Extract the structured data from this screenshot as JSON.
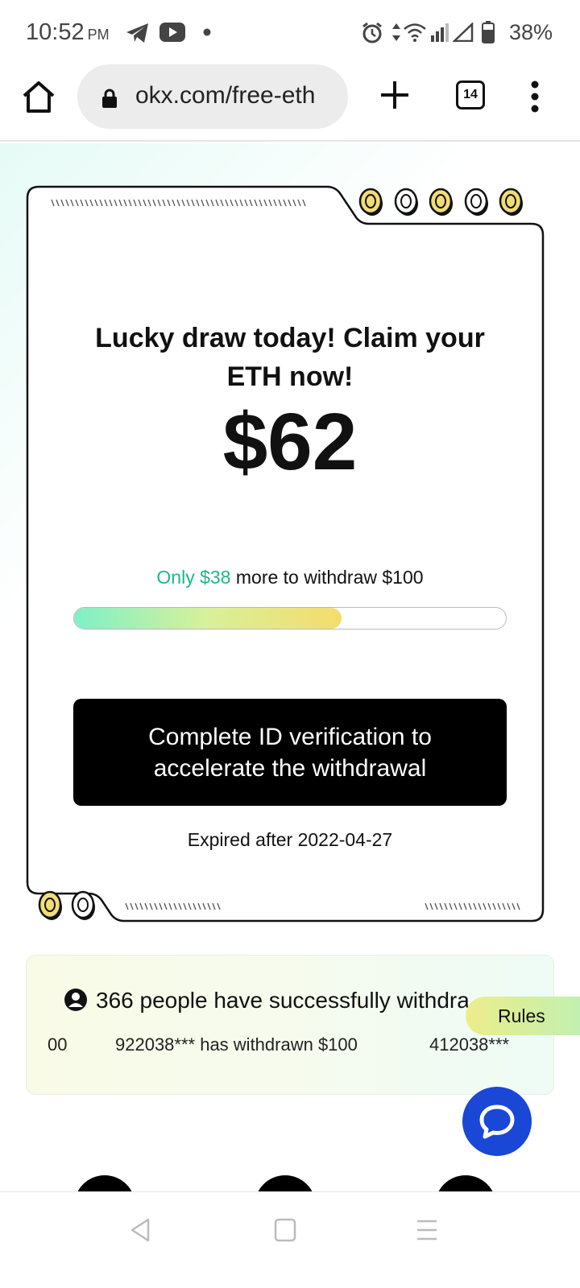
{
  "status_bar": {
    "time": "10:52",
    "ampm": "PM",
    "battery": "38%",
    "icons": [
      "telegram-icon",
      "youtube-icon",
      "dot-icon",
      "alarm-icon",
      "data-arrows-icon",
      "wifi-icon",
      "signal-icon",
      "signal-empty-icon",
      "battery-icon"
    ]
  },
  "browser": {
    "url": "okx.com/free-eth",
    "tab_count": "14"
  },
  "card": {
    "title": "Lucky draw today! Claim your ETH now!",
    "amount": "$62",
    "progress_highlight": "Only $38",
    "progress_rest": " more to withdraw $100",
    "progress_fraction": 0.62,
    "cta_label": "Complete ID verification to accelerate the withdrawal",
    "expiry": "Expired after 2022-04-27"
  },
  "withdraw_panel": {
    "people_text": "366 people have successfully withdra",
    "ticker": [
      "00",
      "922038*** has withdrawn $100",
      "412038***"
    ]
  },
  "rules_label": "Rules",
  "colors": {
    "accent_green": "#1fb58a",
    "fab_blue": "#1a47d6",
    "cta_black": "#000000"
  }
}
